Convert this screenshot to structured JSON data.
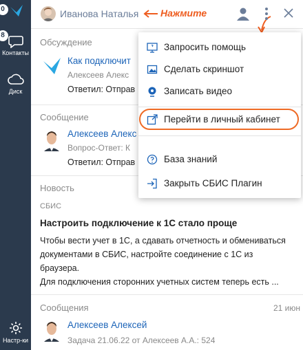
{
  "sidebar": {
    "top_badge": "0",
    "contacts": {
      "badge": "8",
      "label": "Контакты"
    },
    "disk": {
      "label": "Диск"
    },
    "settings": {
      "label": "Настр-ки"
    }
  },
  "header": {
    "user_name": "Иванова Наталья",
    "annotation": "Нажмите"
  },
  "menu": {
    "items": [
      {
        "label": "Запросить помощь",
        "icon": "monitor-help-icon"
      },
      {
        "label": "Сделать скриншот",
        "icon": "screenshot-icon"
      },
      {
        "label": "Записать видео",
        "icon": "record-video-icon"
      },
      {
        "label": "Перейти в личный кабинет",
        "icon": "external-link-icon"
      },
      {
        "label": "База знаний",
        "icon": "help-circle-icon"
      },
      {
        "label": "Закрыть СБИС Плагин",
        "icon": "exit-icon"
      }
    ]
  },
  "feed": {
    "discussion": {
      "title": "Обсуждение",
      "subject": "Как подключит",
      "author": "Алексеев Алекс",
      "reply": "Ответил: Отправ"
    },
    "message": {
      "title": "Сообщение",
      "author": "Алексеев Алекс",
      "qa": "Вопрос-Ответ: К",
      "reply": "Ответил: Отправ"
    },
    "news": {
      "title": "Новость",
      "source": "СБИС",
      "headline": "Настроить подключение к 1С стало проще",
      "body_lines": [
        "Чтобы вести учет в 1С, а сдавать отчетность и обмениваться",
        "документами в СБИС, настройте соединение с 1С из",
        "браузера.",
        "Для подключения сторонних учетных систем теперь есть ..."
      ]
    },
    "messages": {
      "title": "Сообщения",
      "date": "21 июн",
      "author": "Алексеев Алексей",
      "task": "Задача 21.06.22 от Алексеев А.А.: 524"
    }
  }
}
